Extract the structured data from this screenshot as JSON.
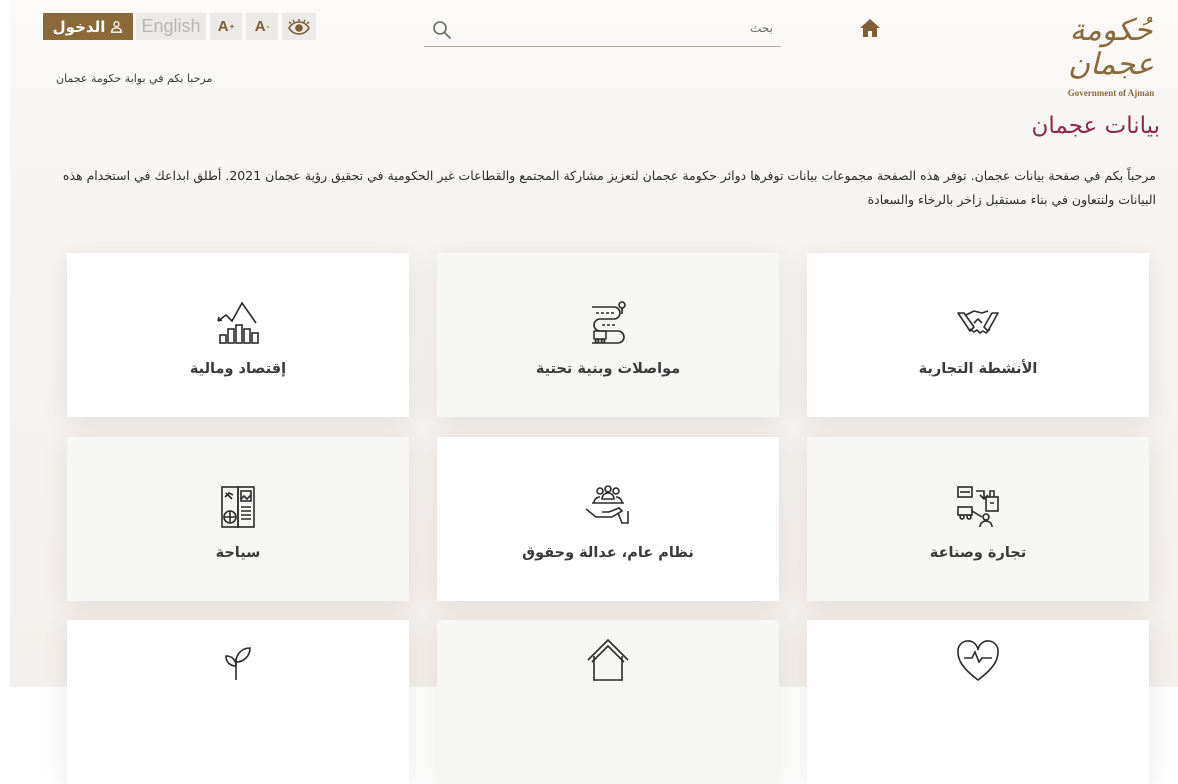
{
  "header": {
    "login_label": "الدخول",
    "language_label": "English",
    "font_increase_label": "A",
    "font_decrease_label": "A",
    "search_placeholder": "بحث",
    "logo_script": "حُكومة عجمان",
    "logo_english": "Government of Ajman"
  },
  "welcome_text": "مرحبا بكم في بوابة حكومة عجمان",
  "page": {
    "title": "بيانات عجمان",
    "intro": "مرحباً بكم في صفحة بيانات عجمان. توفر هذه الصفحة مجموعات بيانات توفرها دوائر حكومة عجمان لتعزيز مشاركة المجتمع والقطاعات غير الحكومية في تحقيق رؤية عجمان 2021. أطلق ابداعك في استخدام هذه البيانات ولنتعاون في بناء مستقبل زاخر بالرخاء والسعادة"
  },
  "categories": [
    {
      "label": "الأنشطة التجارية",
      "icon": "handshake-icon"
    },
    {
      "label": "مواصلات وبنية تحتية",
      "icon": "road-route-icon"
    },
    {
      "label": "إقتصاد ومالية",
      "icon": "economy-chart-icon"
    },
    {
      "label": "تجارة وصناعة",
      "icon": "trade-industry-icon"
    },
    {
      "label": "نظام عام، عدالة وحقوق",
      "icon": "community-hand-icon"
    },
    {
      "label": "سياحة",
      "icon": "tourism-passport-icon"
    },
    {
      "label": "",
      "icon": "heart-pulse-icon"
    },
    {
      "label": "",
      "icon": "house-icon"
    },
    {
      "label": "",
      "icon": "plant-icon"
    }
  ],
  "colors": {
    "brand_gold": "#8a6a38",
    "title_maroon": "#8b2a4a",
    "button_gray": "#eceae8"
  }
}
